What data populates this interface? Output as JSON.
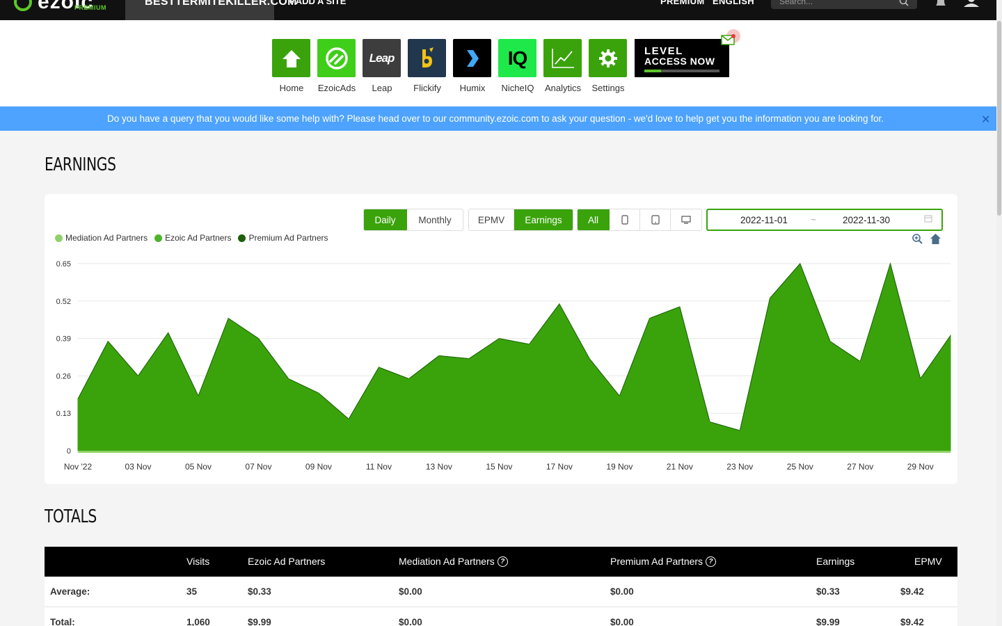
{
  "topnav": {
    "logo_word": "ezoic",
    "logo_sub": "PREMIUM",
    "site_name": "BESTTERMITEKILLER.COM",
    "add_site": "+ ADD A SITE",
    "premium": "PREMIUM",
    "language": "ENGLISH",
    "search_placeholder": "Search..."
  },
  "apps": [
    {
      "label": "Home",
      "color": "#3aa30b",
      "icon": "house-icon"
    },
    {
      "label": "EzoicAds",
      "color": "#3fce1a",
      "icon": "ezoicads-icon"
    },
    {
      "label": "Leap",
      "color": "#3d3d3d",
      "icon": "leap-icon",
      "icon_text": "Leap"
    },
    {
      "label": "Flickify",
      "color": "#21374d",
      "icon": "flickify-icon"
    },
    {
      "label": "Humix",
      "color": "#000000",
      "icon": "humix-icon"
    },
    {
      "label": "NicheIQ",
      "color": "#1ee84a",
      "icon": "nicheiq-icon",
      "icon_text": "IQ"
    },
    {
      "label": "Analytics",
      "color": "#3aa30b",
      "icon": "analytics-icon"
    },
    {
      "label": "Settings",
      "color": "#3aa30b",
      "icon": "gear-icon"
    }
  ],
  "promo": {
    "line1": "LEVEL",
    "line2": "ACCESS NOW"
  },
  "banner": {
    "text": "Do you have a query that you would like some help with? Please head over to our community.ezoic.com to ask your question - we'd love to help get you the information you are looking for."
  },
  "earnings": {
    "heading": "EARNINGS",
    "period_buttons": [
      "Daily",
      "Monthly"
    ],
    "metric_buttons": [
      "EPMV",
      "Earnings"
    ],
    "device_all": "All",
    "date_from": "2022-11-01",
    "date_sep": "~",
    "date_to": "2022-11-30"
  },
  "chart_data": {
    "type": "area",
    "legend": [
      "Mediation Ad Partners",
      "Ezoic Ad Partners",
      "Premium Ad Partners"
    ],
    "legend_colors": [
      "#8fd16a",
      "#4cb32a",
      "#1d5e0b"
    ],
    "x": [
      "Nov '22",
      "02 Nov",
      "03 Nov",
      "04 Nov",
      "05 Nov",
      "06 Nov",
      "07 Nov",
      "08 Nov",
      "09 Nov",
      "10 Nov",
      "11 Nov",
      "12 Nov",
      "13 Nov",
      "14 Nov",
      "15 Nov",
      "16 Nov",
      "17 Nov",
      "18 Nov",
      "19 Nov",
      "20 Nov",
      "21 Nov",
      "22 Nov",
      "23 Nov",
      "24 Nov",
      "25 Nov",
      "26 Nov",
      "27 Nov",
      "28 Nov",
      "29 Nov",
      "30 Nov"
    ],
    "x_tick_labels": [
      "Nov '22",
      "03 Nov",
      "05 Nov",
      "07 Nov",
      "09 Nov",
      "11 Nov",
      "13 Nov",
      "15 Nov",
      "17 Nov",
      "19 Nov",
      "21 Nov",
      "23 Nov",
      "25 Nov",
      "27 Nov",
      "29 Nov"
    ],
    "series": [
      {
        "name": "Mediation Ad Partners",
        "values": [
          0,
          0,
          0,
          0,
          0,
          0,
          0,
          0,
          0,
          0,
          0,
          0,
          0,
          0,
          0,
          0,
          0,
          0,
          0,
          0,
          0,
          0,
          0,
          0,
          0,
          0,
          0,
          0,
          0,
          0
        ]
      },
      {
        "name": "Ezoic Ad Partners",
        "values": [
          0.18,
          0.38,
          0.26,
          0.41,
          0.19,
          0.46,
          0.39,
          0.25,
          0.2,
          0.11,
          0.29,
          0.25,
          0.33,
          0.32,
          0.39,
          0.37,
          0.51,
          0.32,
          0.19,
          0.46,
          0.5,
          0.1,
          0.07,
          0.53,
          0.65,
          0.38,
          0.31,
          0.65,
          0.25,
          0.4
        ]
      },
      {
        "name": "Premium Ad Partners",
        "values": [
          0,
          0,
          0,
          0,
          0,
          0,
          0,
          0,
          0,
          0,
          0,
          0,
          0,
          0,
          0,
          0,
          0,
          0,
          0,
          0,
          0,
          0,
          0,
          0,
          0,
          0,
          0,
          0,
          0,
          0
        ]
      }
    ],
    "y_ticks": [
      "0",
      "0.13",
      "0.26",
      "0.39",
      "0.52",
      "0.65"
    ],
    "ylim": [
      0,
      0.65
    ],
    "grid": true,
    "legend_position": "top-left"
  },
  "totals": {
    "heading": "TOTALS",
    "columns": [
      "Visits",
      "Ezoic Ad Partners",
      "Mediation Ad Partners",
      "Premium Ad Partners",
      "Earnings",
      "EPMV"
    ],
    "rows": [
      {
        "label": "Average:",
        "values": [
          "35",
          "$0.33",
          "$0.00",
          "$0.00",
          "$0.33",
          "$9.42"
        ]
      },
      {
        "label": "Total:",
        "values": [
          "1,060",
          "$9.99",
          "$0.00",
          "$0.00",
          "$9.99",
          "$9.42"
        ]
      }
    ]
  }
}
